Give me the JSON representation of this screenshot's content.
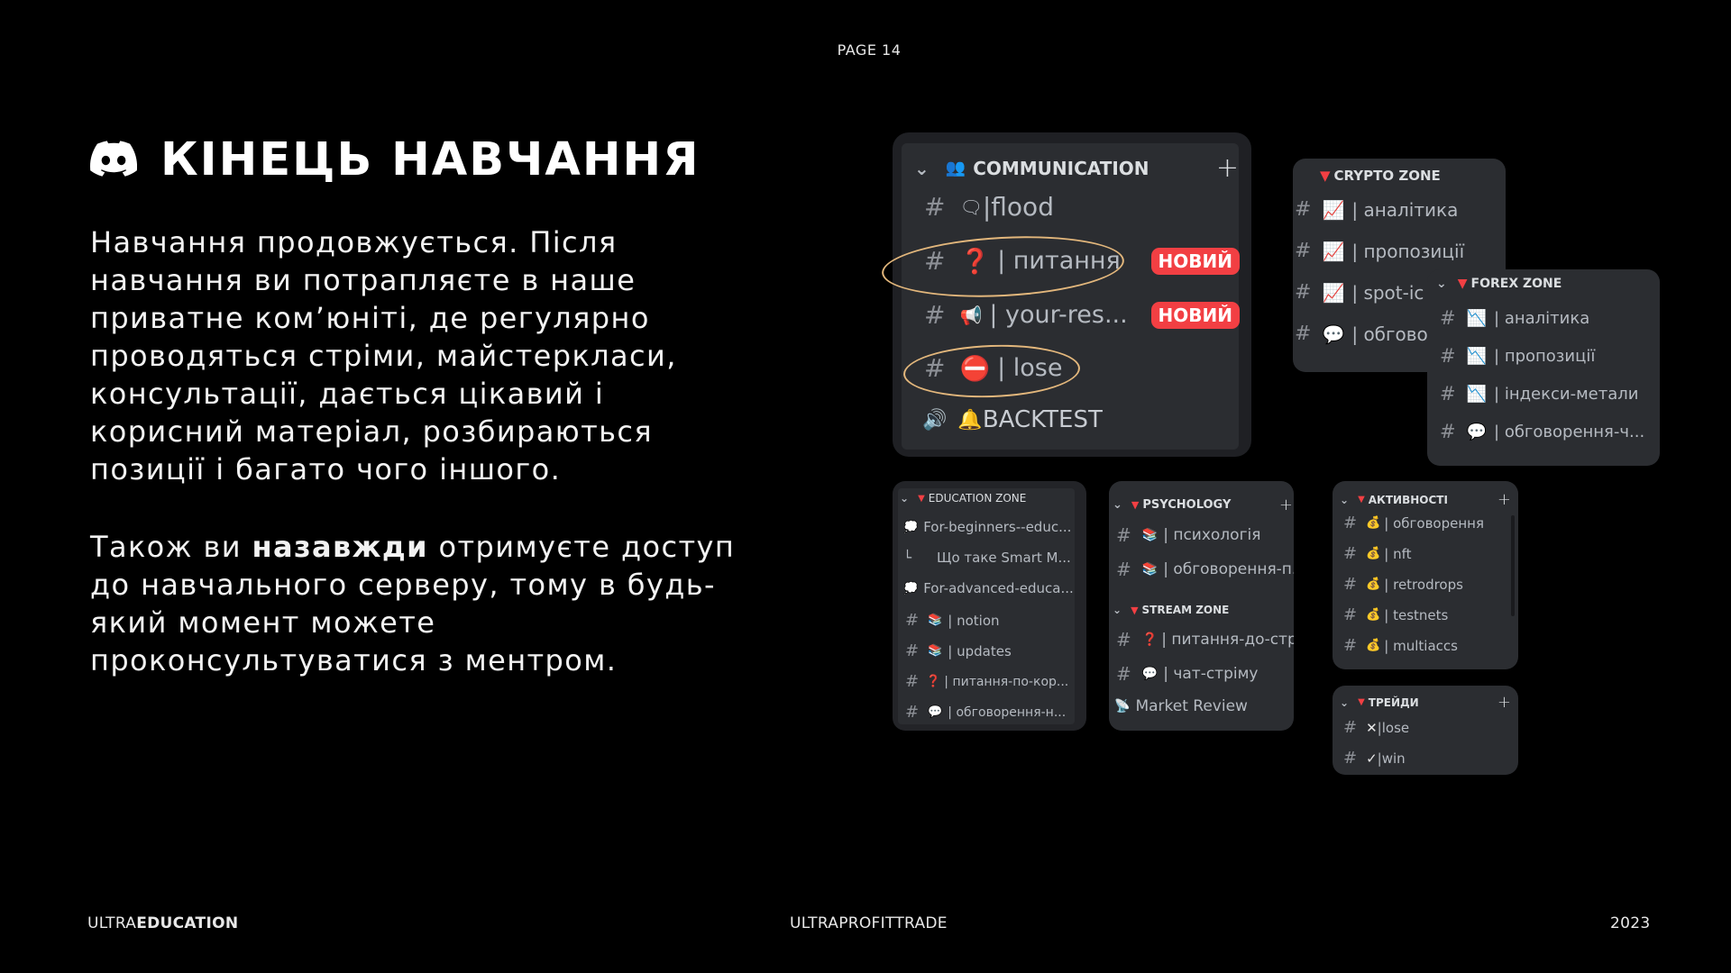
{
  "page": {
    "label": "PAGE 14"
  },
  "title": {
    "text": "КІНЕЦЬ НАВЧАННЯ",
    "icon": "discord-logo"
  },
  "body": {
    "p1": "Навчання продовжується. Після навчання ви потрапляєте в наше приватне ком’юніті, де регулярно проводяться стріми, майстеркласи, консультації, дається цікавий і корисний матеріал, розбираються позиції і багато чого іншого.",
    "p2_a": "Також ви ",
    "p2_b": "назавжди",
    "p2_c": " отримуєте доступ до навчального серверу, тому в будь-який момент можете проконсультуватися з ментром."
  },
  "footer": {
    "left_a": "ULTRA",
    "left_b": "EDUCATION",
    "center": "ULTRAPROFITTRADE",
    "right": "2023"
  },
  "colors": {
    "panel": "#2b2d31",
    "badge": "#f23f43",
    "annotation": "#e3b77c"
  },
  "communication": {
    "category": "COMMUNICATION",
    "channels": [
      {
        "hash": "#",
        "icon": "🗨",
        "name": "|flood"
      },
      {
        "hash": "#",
        "icon": "❓",
        "name": "| питання",
        "badge": "НОВИЙ"
      },
      {
        "hash": "#",
        "icon": "📢",
        "name": "| your-res...",
        "badge": "НОВИЙ"
      },
      {
        "hash": "#",
        "icon": "⛔",
        "name": "| lose"
      },
      {
        "hash": "🔊",
        "icon": "🔔",
        "name": "BACKTEST"
      }
    ]
  },
  "crypto": {
    "category": "CRYPTO ZONE",
    "channels": [
      {
        "hash": "#",
        "icon": "📈",
        "name": "| аналітика"
      },
      {
        "hash": "#",
        "icon": "📈",
        "name": "| пропозиції"
      },
      {
        "hash": "#",
        "icon": "📈",
        "name": "| spot-ic"
      },
      {
        "hash": "#",
        "icon": "💬",
        "name": "| обгово"
      }
    ]
  },
  "forex": {
    "category": "FOREX ZONE",
    "channels": [
      {
        "hash": "#",
        "icon": "📉",
        "name": "| аналітика"
      },
      {
        "hash": "#",
        "icon": "📉",
        "name": "| пропозиції"
      },
      {
        "hash": "#",
        "icon": "📉",
        "name": "| індекси-метали"
      },
      {
        "hash": "#",
        "icon": "💬",
        "name": "| обговорення-ч..."
      }
    ]
  },
  "education": {
    "category": "EDUCATION ZONE",
    "channels": [
      {
        "hash": "💭",
        "icon": "",
        "name": "For-beginners--educ..."
      },
      {
        "hash": "└",
        "icon": "",
        "name": "Що таке Smart M..."
      },
      {
        "hash": "💭",
        "icon": "",
        "name": "For-advanced-educa..."
      },
      {
        "hash": "#",
        "icon": "📚",
        "name": "| notion"
      },
      {
        "hash": "#",
        "icon": "📚",
        "name": "| updates"
      },
      {
        "hash": "#",
        "icon": "❓",
        "name": "| питання-по-кор..."
      },
      {
        "hash": "#",
        "icon": "💬",
        "name": "| обговорення-н..."
      }
    ]
  },
  "psychology": {
    "category": "PSYCHOLOGY",
    "channels": [
      {
        "hash": "#",
        "icon": "📚",
        "name": "| психологія"
      },
      {
        "hash": "#",
        "icon": "📚",
        "name": "| обговорення-п..."
      }
    ],
    "category2": "STREAM ZONE",
    "channels2": [
      {
        "hash": "#",
        "icon": "❓",
        "name": "| питання-до-стрі..."
      },
      {
        "hash": "#",
        "icon": "💬",
        "name": "| чат-стріму"
      },
      {
        "hash": "📡",
        "icon": "",
        "name": "Market Review"
      }
    ]
  },
  "activity": {
    "category": "АКТИВНОСТІ",
    "channels": [
      {
        "hash": "#",
        "icon": "💰",
        "name": "| обговорення"
      },
      {
        "hash": "#",
        "icon": "💰",
        "name": "| nft"
      },
      {
        "hash": "#",
        "icon": "💰",
        "name": "| retrodrops"
      },
      {
        "hash": "#",
        "icon": "💰",
        "name": "| testnets"
      },
      {
        "hash": "#",
        "icon": "💰",
        "name": "| multiaccs"
      }
    ]
  },
  "trades": {
    "category": "ТРЕЙДИ",
    "channels": [
      {
        "hash": "#",
        "icon": "✕",
        "name": "|lose"
      },
      {
        "hash": "#",
        "icon": "✓",
        "name": "|win"
      }
    ]
  }
}
